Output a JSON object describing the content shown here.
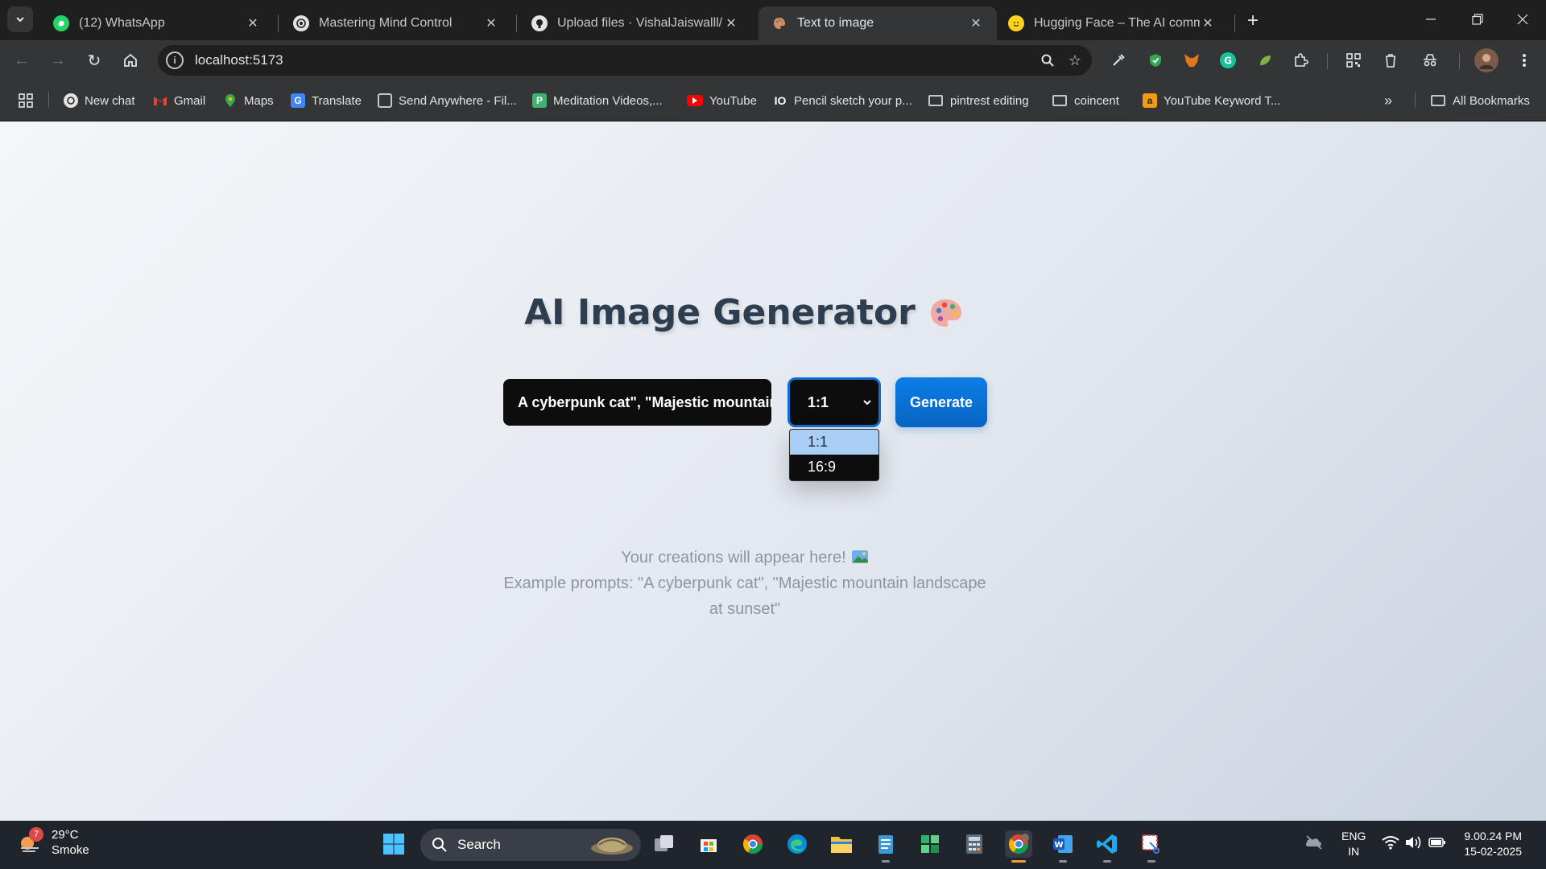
{
  "browser": {
    "tabs": [
      {
        "title": "(12) WhatsApp",
        "icon": "whatsapp-icon",
        "active": false
      },
      {
        "title": "Mastering Mind Control",
        "icon": "chatgpt-icon",
        "active": false
      },
      {
        "title": "Upload files · VishalJaiswalll/Ima",
        "icon": "github-icon",
        "active": false
      },
      {
        "title": "Text to image",
        "icon": "palette-favicon-icon",
        "active": true
      },
      {
        "title": "Hugging Face – The AI commun",
        "icon": "huggingface-icon",
        "active": false
      }
    ],
    "new_tab": "+",
    "address": "localhost:5173",
    "bookmarks": [
      {
        "label": "New chat",
        "icon": "chatgpt-icon"
      },
      {
        "label": "Gmail",
        "icon": "gmail-icon"
      },
      {
        "label": "Maps",
        "icon": "maps-icon"
      },
      {
        "label": "Translate",
        "icon": "translate-icon"
      },
      {
        "label": "Send Anywhere - Fil...",
        "icon": "send-anywhere-icon"
      },
      {
        "label": "Meditation Videos,...",
        "icon": "meditation-icon"
      },
      {
        "label": "YouTube",
        "icon": "youtube-icon"
      },
      {
        "label": "Pencil sketch your p...",
        "icon": "io-icon"
      },
      {
        "label": "pintrest editing",
        "icon": "folder-icon"
      },
      {
        "label": "coincent",
        "icon": "folder-icon"
      },
      {
        "label": "YouTube Keyword T...",
        "icon": "keyword-tool-icon"
      }
    ],
    "all_bookmarks": "All Bookmarks"
  },
  "app": {
    "title": "AI Image Generator",
    "prompt_value": "A cyberpunk cat\", \"Majestic mountain",
    "aspect_selected": "1:1",
    "aspect_options": [
      "1:1",
      "16:9"
    ],
    "generate_label": "Generate",
    "placeholder_line1": "Your creations will appear here!",
    "placeholder_line2": "Example prompts: \"A cyberpunk cat\", \"Majestic mountain landscape at sunset\""
  },
  "taskbar": {
    "weather_badge": "7",
    "temperature": "29°C",
    "condition": "Smoke",
    "search_label": "Search",
    "language": "ENG",
    "region": "IN",
    "time": "9.00.24 PM",
    "date": "15-02-2025"
  },
  "colors": {
    "accent": "#0a70d6",
    "title": "#2c3e50",
    "chrome_dark": "#1f1f1f",
    "chrome_toolbar": "#333537"
  }
}
